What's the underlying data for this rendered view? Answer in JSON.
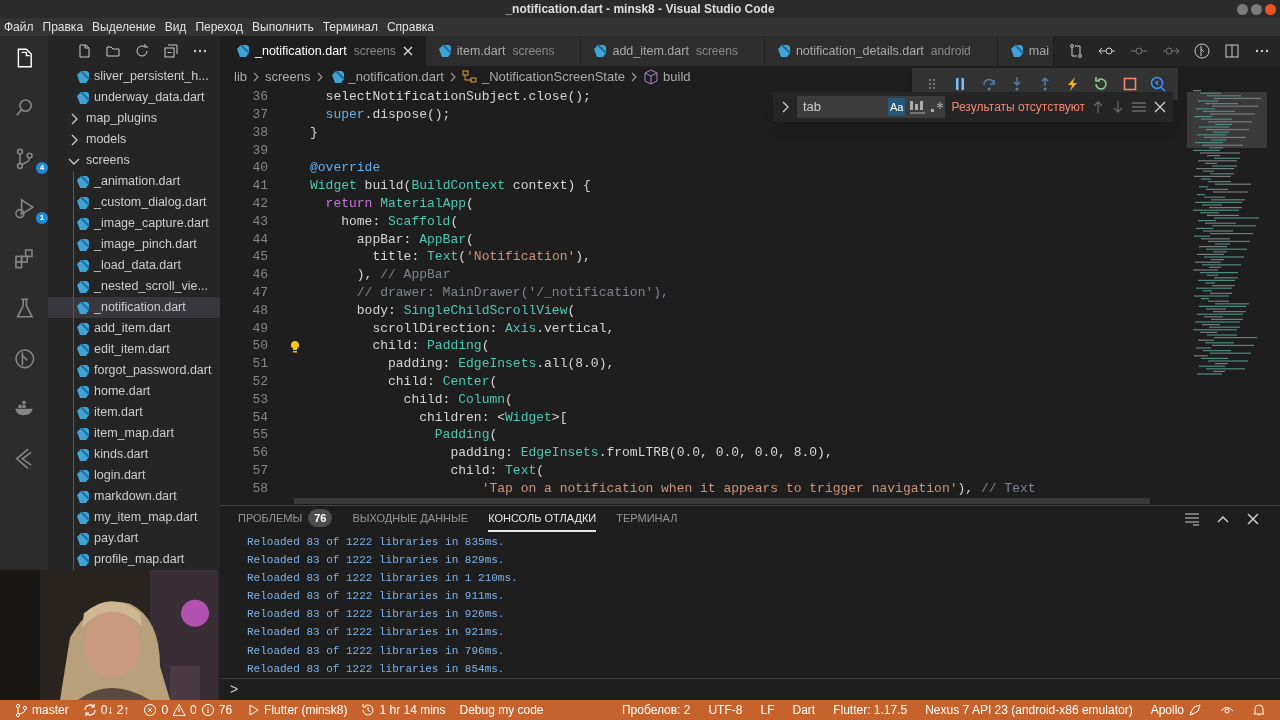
{
  "window": {
    "title": "_notification.dart - minsk8 - Visual Studio Code"
  },
  "menu": [
    "Файл",
    "Правка",
    "Выделение",
    "Вид",
    "Переход",
    "Выполнить",
    "Терминал",
    "Справка"
  ],
  "activity_bar": [
    {
      "selected": true
    },
    {
      "selected": false
    },
    {
      "selected": false,
      "badge": "4"
    },
    {
      "selected": false,
      "badge": "1"
    },
    {
      "selected": false
    },
    {
      "selected": false
    },
    {
      "selected": false
    },
    {
      "selected": false
    },
    {
      "selected": false
    }
  ],
  "explorer": {
    "items": [
      {
        "kind": "file",
        "label": "sliver_persistent_h...",
        "selected": false
      },
      {
        "kind": "file",
        "label": "underway_data.dart",
        "selected": false
      },
      {
        "kind": "folder",
        "label": "map_plugins",
        "expanded": false,
        "selected": false
      },
      {
        "kind": "folder",
        "label": "models",
        "expanded": false,
        "selected": false
      },
      {
        "kind": "folder",
        "label": "screens",
        "expanded": true,
        "selected": false,
        "children": [
          {
            "kind": "file",
            "label": "_animation.dart",
            "selected": false
          },
          {
            "kind": "file",
            "label": "_custom_dialog.dart",
            "selected": false
          },
          {
            "kind": "file",
            "label": "_image_capture.dart",
            "selected": false
          },
          {
            "kind": "file",
            "label": "_image_pinch.dart",
            "selected": false
          },
          {
            "kind": "file",
            "label": "_load_data.dart",
            "selected": false
          },
          {
            "kind": "file",
            "label": "_nested_scroll_vie...",
            "selected": false
          },
          {
            "kind": "file",
            "label": "_notification.dart",
            "selected": true
          },
          {
            "kind": "file",
            "label": "add_item.dart",
            "selected": false
          },
          {
            "kind": "file",
            "label": "edit_item.dart",
            "selected": false
          },
          {
            "kind": "file",
            "label": "forgot_password.dart",
            "selected": false
          },
          {
            "kind": "file",
            "label": "home.dart",
            "selected": false
          },
          {
            "kind": "file",
            "label": "item.dart",
            "selected": false
          },
          {
            "kind": "file",
            "label": "item_map.dart",
            "selected": false
          },
          {
            "kind": "file",
            "label": "kinds.dart",
            "selected": false
          },
          {
            "kind": "file",
            "label": "login.dart",
            "selected": false
          },
          {
            "kind": "file",
            "label": "markdown.dart",
            "selected": false
          },
          {
            "kind": "file",
            "label": "my_item_map.dart",
            "selected": false
          },
          {
            "kind": "file",
            "label": "pay.dart",
            "selected": false
          },
          {
            "kind": "file",
            "label": "profile_map.dart",
            "selected": false
          }
        ]
      }
    ]
  },
  "webcam": {
    "kind": "picture"
  },
  "tabs": [
    {
      "label": "_notification.dart",
      "description": "screens",
      "selected": true
    },
    {
      "label": "item.dart",
      "description": "screens",
      "selected": false
    },
    {
      "label": "add_item.dart",
      "description": "screens",
      "selected": false
    },
    {
      "label": "notification_details.dart",
      "description": "android",
      "selected": false
    },
    {
      "label": "mai",
      "selected": false
    }
  ],
  "breadcrumbs": [
    "lib",
    "screens",
    "_notification.dart",
    "_NotificationScreenState",
    "build"
  ],
  "debug_toolbar": {
    "paused": false
  },
  "find_widget": {
    "query": "tab",
    "match_case": {
      "label": "Aa",
      "on": true
    },
    "whole_word": false,
    "regex": false,
    "result": "Результаты отсутствуют"
  },
  "code": [
    {
      "number": "36",
      "tokens": [
        {
          "kind": "txt",
          "text": "  selectNotificationSubject.close();"
        }
      ]
    },
    {
      "number": "37",
      "tokens": [
        {
          "kind": "kw2",
          "text": "  super"
        },
        {
          "kind": "txt",
          "text": ".dispose();"
        }
      ]
    },
    {
      "number": "38",
      "tokens": [
        {
          "kind": "txt",
          "text": "}"
        }
      ]
    },
    {
      "number": "39"
    },
    {
      "number": "40",
      "tokens": [
        {
          "kind": "kw2",
          "text": "@override"
        }
      ]
    },
    {
      "number": "41",
      "tokens": [
        {
          "kind": "type",
          "text": "Widget"
        },
        {
          "kind": "txt",
          "text": " build("
        },
        {
          "kind": "type",
          "text": "BuildContext"
        },
        {
          "kind": "txt",
          "text": " context) {"
        }
      ]
    },
    {
      "number": "42",
      "tokens": [
        {
          "kind": "kw",
          "text": "  return "
        },
        {
          "kind": "type",
          "text": "MaterialApp"
        },
        {
          "kind": "txt",
          "text": "("
        }
      ]
    },
    {
      "number": "43",
      "tokens": [
        {
          "kind": "txt",
          "text": "    home: "
        },
        {
          "kind": "type",
          "text": "Scaffold"
        },
        {
          "kind": "txt",
          "text": "("
        }
      ]
    },
    {
      "number": "44",
      "tokens": [
        {
          "kind": "txt",
          "text": "      appBar: "
        },
        {
          "kind": "type",
          "text": "AppBar"
        },
        {
          "kind": "txt",
          "text": "("
        }
      ]
    },
    {
      "number": "45",
      "tokens": [
        {
          "kind": "txt",
          "text": "        title: "
        },
        {
          "kind": "type",
          "text": "Text"
        },
        {
          "kind": "txt",
          "text": "("
        },
        {
          "kind": "str",
          "text": "'Notification'"
        },
        {
          "kind": "txt",
          "text": "),"
        }
      ]
    },
    {
      "number": "46",
      "tokens": [
        {
          "kind": "txt",
          "text": "      ), "
        },
        {
          "kind": "cmt",
          "text": "// AppBar"
        }
      ]
    },
    {
      "number": "47",
      "tokens": [
        {
          "kind": "cmt",
          "text": "      // drawer: MainDrawer('/_notification'),"
        }
      ]
    },
    {
      "number": "48",
      "tokens": [
        {
          "kind": "txt",
          "text": "      body: "
        },
        {
          "kind": "type",
          "text": "SingleChildScrollView"
        },
        {
          "kind": "txt",
          "text": "("
        }
      ]
    },
    {
      "number": "49",
      "tokens": [
        {
          "kind": "txt",
          "text": "        scrollDirection: "
        },
        {
          "kind": "type",
          "text": "Axis"
        },
        {
          "kind": "txt",
          "text": ".vertical,"
        }
      ]
    },
    {
      "number": "50",
      "lightbulb": true,
      "tokens": [
        {
          "kind": "txt",
          "text": "        child: "
        },
        {
          "kind": "type",
          "text": "Padding"
        },
        {
          "kind": "txt",
          "text": "("
        }
      ]
    },
    {
      "number": "51",
      "tokens": [
        {
          "kind": "txt",
          "text": "          padding: "
        },
        {
          "kind": "type",
          "text": "EdgeInsets"
        },
        {
          "kind": "txt",
          "text": ".all(8.0),"
        }
      ]
    },
    {
      "number": "52",
      "tokens": [
        {
          "kind": "txt",
          "text": "          child: "
        },
        {
          "kind": "type",
          "text": "Center"
        },
        {
          "kind": "txt",
          "text": "("
        }
      ]
    },
    {
      "number": "53",
      "tokens": [
        {
          "kind": "txt",
          "text": "            child: "
        },
        {
          "kind": "type",
          "text": "Column"
        },
        {
          "kind": "txt",
          "text": "("
        }
      ]
    },
    {
      "number": "54",
      "tokens": [
        {
          "kind": "txt",
          "text": "              children: <"
        },
        {
          "kind": "type",
          "text": "Widget"
        },
        {
          "kind": "txt",
          "text": ">["
        }
      ]
    },
    {
      "number": "55",
      "tokens": [
        {
          "kind": "type",
          "text": "                Padding"
        },
        {
          "kind": "txt",
          "text": "("
        }
      ]
    },
    {
      "number": "56",
      "tokens": [
        {
          "kind": "txt",
          "text": "                  padding: "
        },
        {
          "kind": "type",
          "text": "EdgeInsets"
        },
        {
          "kind": "txt",
          "text": ".fromLTRB(0.0, 0.0, 0.0, 8.0),"
        }
      ]
    },
    {
      "number": "57",
      "tokens": [
        {
          "kind": "txt",
          "text": "                  child: "
        },
        {
          "kind": "type",
          "text": "Text"
        },
        {
          "kind": "txt",
          "text": "("
        }
      ]
    },
    {
      "number": "58",
      "tokens": [
        {
          "kind": "str",
          "text": "                      'Tap on a notification when it appears to trigger navigation'"
        },
        {
          "kind": "txt",
          "text": "), "
        },
        {
          "kind": "cmt",
          "text": "// Text"
        }
      ]
    }
  ],
  "panel": {
    "tabs": [
      {
        "label": "ПРОБЛЕМЫ",
        "badge": "76",
        "selected": false
      },
      {
        "label": "ВЫХОДНЫЕ ДАННЫЕ",
        "selected": false
      },
      {
        "label": "КОНСОЛЬ ОТЛАДКИ",
        "selected": true
      },
      {
        "label": "ТЕРМИНАЛ",
        "selected": false
      }
    ],
    "console": [
      "Reloaded 83 of 1222 libraries in 835ms.",
      "Reloaded 83 of 1222 libraries in 829ms.",
      "Reloaded 83 of 1222 libraries in 1 210ms.",
      "Reloaded 83 of 1222 libraries in 911ms.",
      "Reloaded 83 of 1222 libraries in 926ms.",
      "Reloaded 83 of 1222 libraries in 921ms.",
      "Reloaded 83 of 1222 libraries in 796ms.",
      "Reloaded 83 of 1222 libraries in 854ms."
    ],
    "prompt": ">"
  },
  "status_bar": {
    "branch": "master",
    "sync": "0↓ 2↑",
    "errors": "0",
    "warnings": "0",
    "infos": "76",
    "launch": "Flutter (minsk8)",
    "session_time": "1 hr 14 mins",
    "debug_mode": "Debug my code",
    "right": [
      "Пробелов: 2",
      "UTF-8",
      "LF",
      "Dart",
      "Flutter: 1.17.5",
      "Nexus 7 API 23 (android-x86 emulator)"
    ],
    "extension": "Apollo"
  }
}
